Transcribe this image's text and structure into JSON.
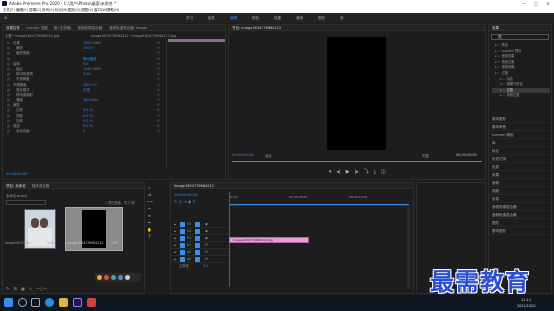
{
  "window": {
    "title": "Adobe Premiere Pro 2020 - C:\\用户\\Photo\\桌面\\未命名 *"
  },
  "menu": [
    "文件(F)",
    "编辑(E)",
    "剪辑(C)",
    "序列(S)",
    "标记(M)",
    "图形(G)",
    "视图(V)",
    "窗口(W)",
    "帮助(H)"
  ],
  "workspaces": [
    "学习",
    "组件",
    "编辑",
    "颜色",
    "效果",
    "音频",
    "图形",
    "库"
  ],
  "effect_controls": {
    "tabs": [
      "效果控件",
      "Lumetri 范围",
      "源:(无剪辑)",
      "音频剪辑混合器:",
      "音频轨道混合器: Image"
    ],
    "clip": "主要 * Image1634776984212.jpg",
    "seq": "Image1634776984212 * Image1634776984212.jpg",
    "rows": [
      {
        "label": "位置",
        "value": "1350  1800"
      },
      {
        "label": "缩放",
        "value": "100.0"
      },
      {
        "label": "缩放宽度",
        "value": ""
      },
      {
        "label": "",
        "value": "等比缩放"
      },
      {
        "label": "旋转",
        "value": "0.0"
      },
      {
        "label": "锚点",
        "value": "1350  1800"
      },
      {
        "label": "防闪烁滤镜",
        "value": "0.00"
      },
      {
        "label": "不透明度",
        "value": ""
      },
      {
        "label": "不透明度",
        "value": "100.0 %"
      },
      {
        "label": "混合模式",
        "value": "正常"
      },
      {
        "label": "时间重映射",
        "value": ""
      },
      {
        "label": "速度",
        "value": "100.00%"
      },
      {
        "label": "裁剪",
        "value": ""
      },
      {
        "label": "左侧",
        "value": "0.0 %"
      },
      {
        "label": "顶部",
        "value": "0.0 %"
      },
      {
        "label": "右侧",
        "value": "0.0 %"
      },
      {
        "label": "底部",
        "value": "0.0 %"
      },
      {
        "label": "羽化边缘",
        "value": "0"
      }
    ],
    "timecode": "00:00:00:00"
  },
  "program": {
    "tabs": [
      "节目: Image1634776984212"
    ],
    "timecode": "00:00:00:00",
    "fit": "适合",
    "scale": "完整",
    "end_timecode": "00:00:05:00"
  },
  "project": {
    "tabs": [
      "项目: 未命名",
      "媒体浏览器"
    ],
    "file": "未命名.prproj",
    "count": "1 项已选择，共 2 项",
    "items": [
      {
        "name": "Image1634776...",
        "dur": "5:00"
      },
      {
        "name": "Image1634776984212",
        "dur": "5:00"
      }
    ]
  },
  "timeline": {
    "tab": "Image1634776984212",
    "timecode": "00:00:00:00",
    "ruler": [
      "00:00",
      "00:00:05:00",
      "00:00:10:00"
    ],
    "tracks": [
      "V3",
      "V2",
      "V1",
      "A1",
      "A2",
      "A3"
    ],
    "master": "主声道",
    "master_val": "0.0",
    "clip": "Image1634776984212.jpg"
  },
  "right": {
    "search_placeholder": "视",
    "tree": [
      "预设",
      "Lumetri 预设",
      "音频效果",
      "音频过渡",
      "视频效果",
      "过渡",
      "杂色",
      "模糊与锐化",
      "过渡",
      "视频过渡"
    ],
    "panels": [
      "基本图形",
      "基本声音",
      "Lumetri 颜色",
      "库",
      "标记",
      "历史记录",
      "信息",
      "效果",
      "音频",
      "视频",
      "信息",
      "音频剪辑混合器",
      "音频轨道混合器",
      "图形",
      "基本图形"
    ]
  },
  "watermark": "最需教育",
  "clock": {
    "time": "11:12",
    "date": "2021/10/21"
  },
  "colors": {
    "accent": "#3b8fe8",
    "clip": "#e79bd8",
    "playhead": "#d32c2c"
  }
}
